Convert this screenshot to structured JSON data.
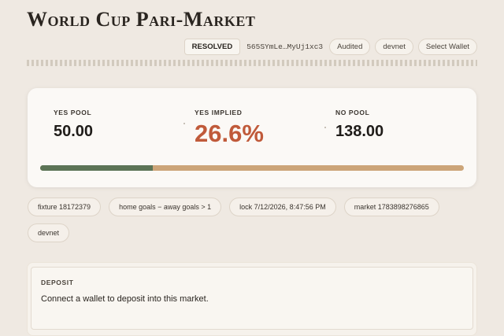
{
  "header": {
    "title": "World Cup Pari-Market",
    "status_badge": "RESOLVED",
    "address": "565SYmLe…MyUj1xc3",
    "audited_label": "Audited",
    "network_label": "devnet",
    "wallet_button": "Select Wallet"
  },
  "pools": {
    "yes_pool_label": "YES POOL",
    "yes_pool_value": "50.00",
    "implied_label": "YES IMPLIED",
    "implied_value": "26.6%",
    "no_pool_label": "NO POOL",
    "no_pool_value": "138.00",
    "yes_share": 0.266
  },
  "tags": [
    "fixture 18172379",
    "home goals − away goals > 1",
    "lock 7/12/2026, 8:47:56 PM",
    "market 1783898276865",
    "devnet"
  ],
  "deposit": {
    "heading": "DEPOSIT",
    "message": "Connect a wallet to deposit into this market."
  },
  "colors": {
    "yes_bar": "#5c7456",
    "no_bar": "#cca579",
    "implied_accent": "#c05a3a"
  }
}
